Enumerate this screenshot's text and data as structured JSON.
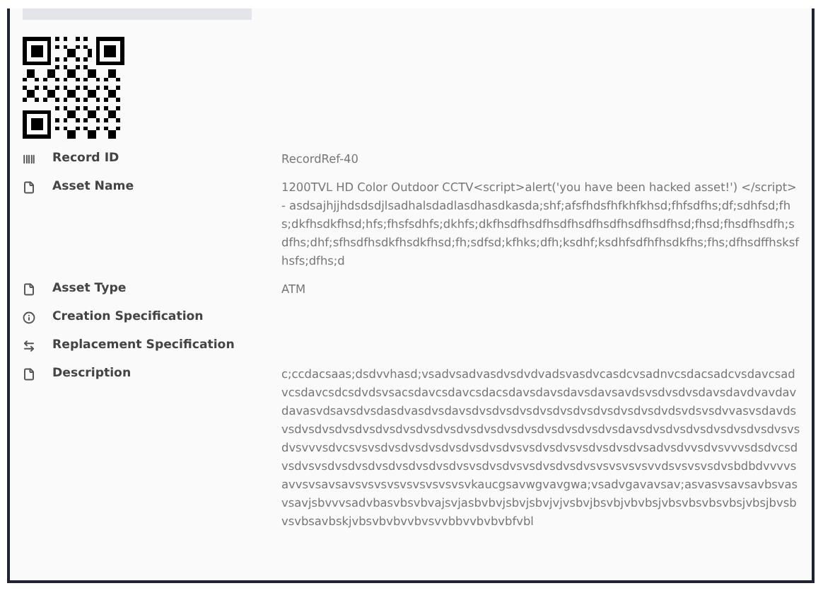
{
  "fields": [
    {
      "kind": "barcode",
      "label": "Record ID",
      "value": "RecordRef-40"
    },
    {
      "kind": "document",
      "label": "Asset Name",
      "value": "1200TVL HD Color Outdoor CCTV<script>alert('you have been hacked asset!') </script>- asdsajhjjhdsdsdjlsadhalsdadlasdhasdkasda;shf;afsfhdsfhfkhfkhsd;fhfsdfhs;df;sdhfsd;fhs;dkfhsdkfhsd;hfs;fhsfsdhfs;dkhfs;dkfhsdfhsdfhsdfhsdfhsdfhsdfhsdfhsd;fhsd;fhsdfhsdfh;sdfhs;dhf;sfhsdfhsdkfhsdkfhsd;fh;sdfsd;kfhks;dfh;ksdhf;ksdhfsdfhfhsdkfhs;fhs;dfhsdffhsksfhsfs;dfhs;d"
    },
    {
      "kind": "document",
      "label": "Asset Type",
      "value": "ATM"
    },
    {
      "kind": "info",
      "label": "Creation Specification"
    },
    {
      "kind": "swap",
      "label": "Replacement Specification"
    },
    {
      "kind": "document",
      "label": "Description",
      "value": "c;ccdacsaas;dsdvvhasd;vsadvsadvasdvsdvdvadsvasdvcasdcvsadnvcsdacsadcvsdavcsadvcsdavcsdcsdvdsvsacsdavcsdavcsdacsdavsdavsdavsdavsavdsvsdvsdvsdavsdavdvavdavdavasvdsavsdvsdasdvasdvsdavsdvsdvsdvsdvsdvsdvsdvsdvsdvsdvdsvdsvsdvvasvsdavdsvsdvsdvsdvsdvsdvsdvsdvsdvsdvsdvsdvsdvsdvsdvsdvsdvsdavsdvsdvsdvsdvsdvsdvsdvsvsdvsvvvsdvcsvsvsdvsdvsdvsdvsdvsdvsdvsvsdvsdvsvsdvsdvsdvsadvsdvvsdvsvvvsdsdvcsdvsdvsvsdvsdvsdvsdvsdvsdvsdvsvsdvsdvsvsdvsdvsdvsvsvsvsvsvvdsvsvsvsdvsbdbdvvvvsavvsvsavsavsvsvsvsvsvsvsvsvsvkaucgsavwgvavgwa;vsadvgavavsav;asvasvsavsavbsvasvsavjsbvvvsadvbasvbsvbvajsvjasbvbvjsbvjsbvjvjvsbvjbsvbjvbvbsjvbsvbsvbsvbsjvbsjbvsbvsvbsavbskjvbsvbvbvvbvsvvbbvvbvbvbfvbl"
    }
  ]
}
